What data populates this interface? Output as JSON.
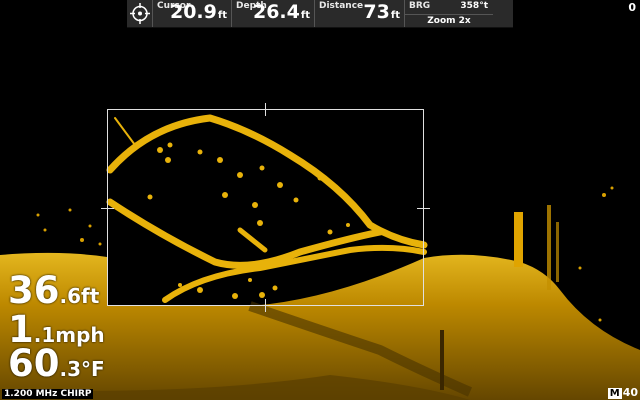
{
  "status_bar": {
    "cursor": {
      "label": "Cursor",
      "value": "20.9",
      "unit": "ft"
    },
    "depth": {
      "label": "Depth",
      "value": "26.4",
      "unit": "ft"
    },
    "distance": {
      "label": "Distance",
      "value": "73",
      "unit": "ft"
    },
    "bearing": {
      "label": "BRG",
      "value": "358°t"
    },
    "zoom": "Zoom 2x"
  },
  "top_right_indicator": "0",
  "readouts": {
    "depth": {
      "value": "36",
      "decimal": ".6",
      "unit": "ft"
    },
    "speed": {
      "value": "1",
      "decimal": ".1",
      "unit": "mph"
    },
    "temperature": {
      "value": "60",
      "decimal": ".3",
      "unit": "°F"
    }
  },
  "frequency_label": "1.200 MHz CHIRP",
  "range": {
    "badge": "M",
    "value": "40"
  },
  "colors": {
    "sonar_primary": "#e8b20a",
    "sonar_dark": "#8a6200",
    "background": "#000000"
  }
}
